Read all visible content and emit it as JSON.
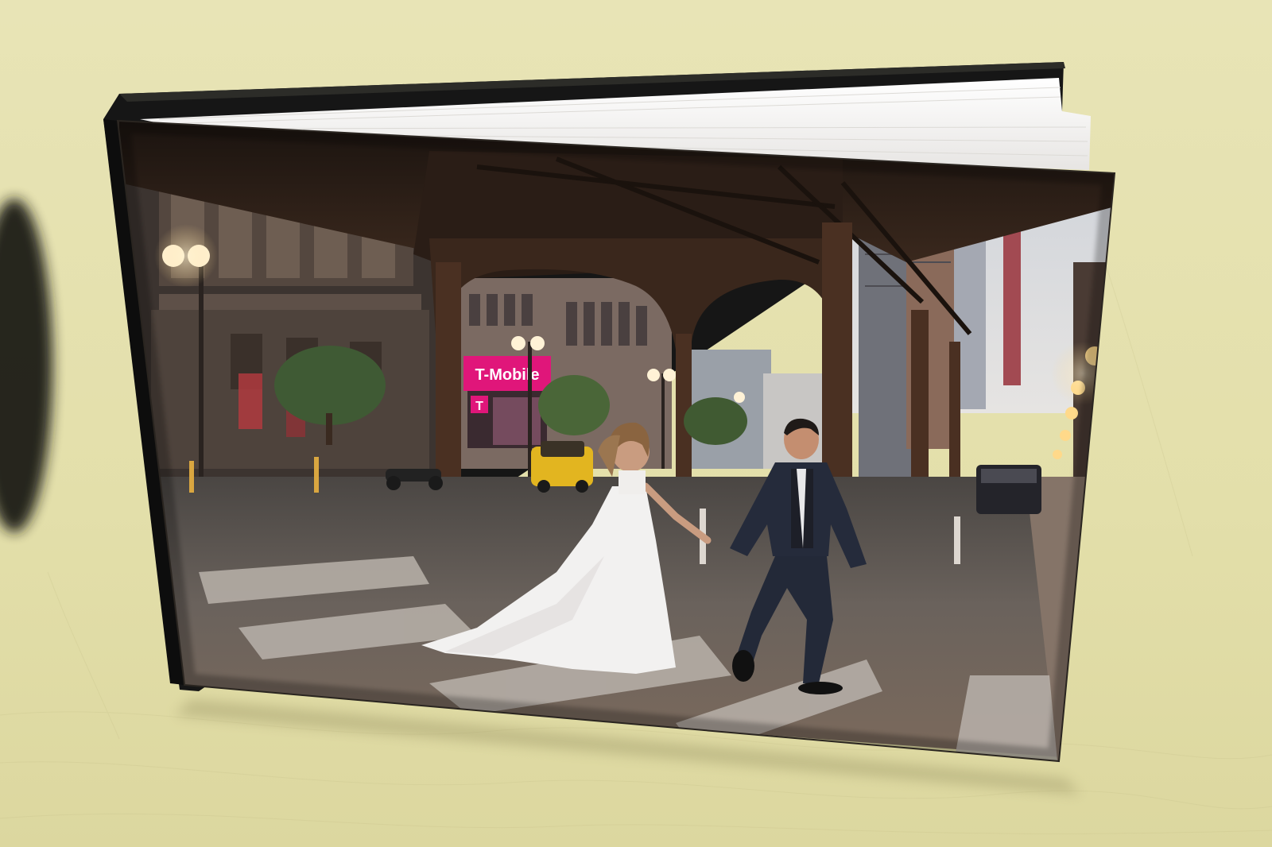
{
  "scene": {
    "subject": "photo-book",
    "colors": {
      "backdrop": "#e6e2b0",
      "backdrop_shadow": "#cfca95",
      "pages": "#f4f2ee",
      "spine": "#1a1a1a"
    }
  },
  "cover_photo": {
    "signage": {
      "store_sign": "T-Mobile",
      "store_logo": "T"
    },
    "colors": {
      "sign_magenta": "#e0167a",
      "taxi_yellow": "#e2b520",
      "dress_white": "#f2f1f0",
      "suit_navy": "#252b3b",
      "girder_brown": "#4a3022",
      "street_gray": "#6e6863",
      "lamp_glow": "#ffe7b0"
    }
  }
}
